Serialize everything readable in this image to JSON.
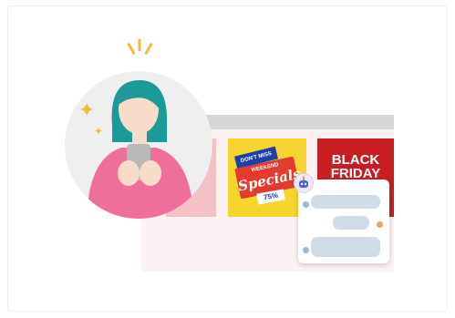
{
  "colors": {
    "browser_bg": "#fdf2f3",
    "browser_bar": "#d6d6d6",
    "yellow_card": "#f6d52f",
    "red_card": "#c81e22",
    "pink_card": "#f3c0c4",
    "person_shirt": "#ef6f9c",
    "person_hair": "#1c9a9a",
    "accent_yellow": "#f3b93b",
    "chat_bubble": "#cfdbe6"
  },
  "ad_weekend": {
    "line1": "DON'T MISS OUR",
    "line2": "WEEKEND",
    "line3": "Specials",
    "offer": "75%"
  },
  "ad_black_friday": {
    "line1": "BLACK",
    "line2": "FRIDAY"
  },
  "icons": {
    "sparkle": "sparkle-icon",
    "bot": "bot-icon",
    "phone": "smartphone-icon"
  }
}
